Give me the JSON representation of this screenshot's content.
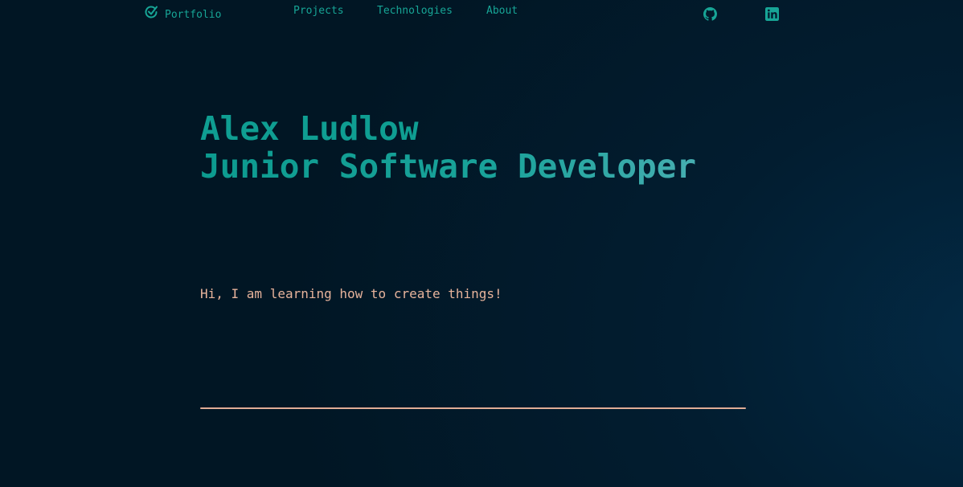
{
  "nav": {
    "logo_text": "Portfolio",
    "links": [
      {
        "label": "Projects"
      },
      {
        "label": "Technologies"
      },
      {
        "label": "About"
      }
    ],
    "social": [
      "github-icon",
      "linkedin-icon"
    ]
  },
  "hero": {
    "name": "Alex Ludlow",
    "role": "Junior Software Developer",
    "tagline": "Hi, I am learning how to create things!"
  },
  "colors": {
    "background": "#021a2c",
    "accent": "#17a596",
    "tagline": "#e7b39b",
    "divider": "#e0ad96"
  }
}
